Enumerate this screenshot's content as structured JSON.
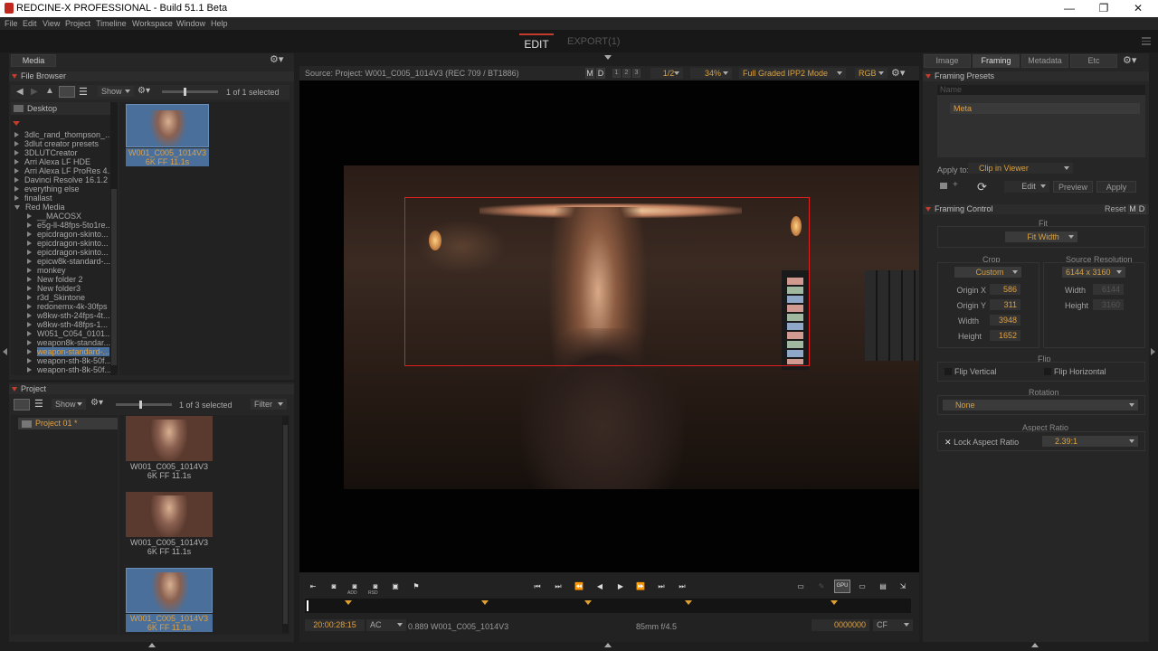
{
  "window": {
    "title": "REDCINE-X PROFESSIONAL - Build 51.1 Beta",
    "minimize": "—",
    "maximize": "❐",
    "close": "✕"
  },
  "menu": [
    "File",
    "Edit",
    "View",
    "Project",
    "Timeline",
    "Workspace",
    "Window",
    "Help"
  ],
  "top_tabs": {
    "edit": "EDIT",
    "export": "EXPORT(1)"
  },
  "media": {
    "tab": "Media",
    "browser_title": "File Browser",
    "show": "Show",
    "selected": "1 of 1 selected",
    "location": "Desktop",
    "tree": [
      "3dlc_rand_thompson_...",
      "3dlut creator presets",
      "3DLUTCreator",
      "Arri Alexa LF HDE",
      "Arri Alexa LF ProRes 4...",
      "Davinci Resolve 16.1.2",
      "everything else",
      "finallast",
      "Red Media",
      "__MACOSX",
      "e5g-ll-48fps-5to1re...",
      "epicdragon-skinto...",
      "epicdragon-skinto...",
      "epicdragon-skinto...",
      "epicw8k-standard-...",
      "monkey",
      "New folder 2",
      "New folder3",
      "r3d_Skintone",
      "redonemx-4k-30fps",
      "w8kw-sth-24fps-4t...",
      "w8kw-sth-48fps-1...",
      "W051_C054_0101...",
      "weapon8k-standar...",
      "weapon-standard-...",
      "weapon-sth-8k-50f...",
      "weapon-sth-8k-50f..."
    ],
    "thumb_name": "W001_C005_1014V3",
    "thumb_meta": "6K FF   11.1s"
  },
  "project": {
    "title": "Project",
    "show": "Show",
    "selected": "1 of 3 selected",
    "filter": "Filter",
    "name": "Project 01 *",
    "clips": [
      {
        "name": "W001_C005_1014V3",
        "meta": "6K FF   11.1s"
      },
      {
        "name": "W001_C005_1014V3",
        "meta": "6K FF   11.1s"
      },
      {
        "name": "W001_C005_1014V3",
        "meta": "6K FF   11.1s"
      }
    ]
  },
  "viewer": {
    "source": "Source: Project: W001_C005_1014V3    (REC 709 / BT1886)",
    "m": "M",
    "d": "D",
    "n1": "1",
    "n2": "2",
    "n3": "3",
    "res": "1/2",
    "zoom": "34%",
    "mode": "Full Graded IPP2 Mode",
    "rgb": "RGB"
  },
  "timeline": {
    "add": "ADD",
    "rsd": "RSD",
    "timecode": "20:00:28:15",
    "ac": "AC",
    "clipinfo": "0.889 W001_C005_1014V3",
    "lens": "85mm f/4.5",
    "frame": "0000000",
    "cf": "CF",
    "gpu": "GPU"
  },
  "right": {
    "tabs": [
      "Image",
      "Framing",
      "Metadata",
      "Etc"
    ],
    "presets_title": "Framing Presets",
    "name_col": "Name",
    "preset_item": "Meta",
    "apply_to_label": "Apply to:",
    "apply_to_value": "Clip in Viewer",
    "edit": "Edit",
    "preview": "Preview",
    "apply": "Apply",
    "control_title": "Framing Control",
    "reset": "Reset",
    "m": "M",
    "d": "D",
    "fit_label": "Fit",
    "fit_value": "Fit Width",
    "crop_label": "Crop",
    "crop_value": "Custom",
    "origin_x_label": "Origin X",
    "origin_x": "586",
    "origin_y_label": "Origin Y",
    "origin_y": "311",
    "width_label": "Width",
    "width": "3948",
    "height_label": "Height",
    "height": "1652",
    "src_label": "Source Resolution",
    "src_value": "6144 x 3160",
    "src_width": "6144",
    "src_height": "3160",
    "flip_label": "Flip",
    "flip_v": "Flip Vertical",
    "flip_h": "Flip Horizontal",
    "rotation_label": "Rotation",
    "rotation_value": "None",
    "aspect_label": "Aspect Ratio",
    "lock_aspect": "Lock Aspect Ratio",
    "aspect_value": "2.39:1",
    "x_mark": "✕"
  },
  "colors": {
    "accent": "#c43c2c",
    "orange": "#e0a040",
    "selection": "#4a6f9a"
  }
}
